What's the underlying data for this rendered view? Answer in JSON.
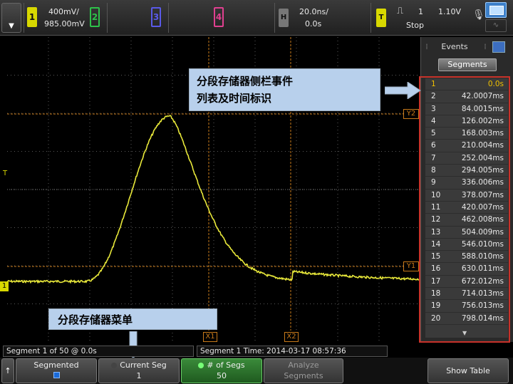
{
  "topbar": {
    "drop_glyph": "▼",
    "ch1": {
      "num": "1",
      "scale": "400mV/",
      "offset": "985.00mV",
      "color": "#d8d800"
    },
    "ch2": {
      "num": "2",
      "color": "#2ec24a"
    },
    "ch3": {
      "num": "3",
      "color": "#5a5ae8"
    },
    "ch4": {
      "num": "4",
      "color": "#e04090"
    },
    "horiz": {
      "label": "H",
      "scale": "20.0ns/",
      "delay": "0.0s"
    },
    "trigger": {
      "label": "T",
      "edge": "⎍",
      "source": "1",
      "level": "1.10V",
      "mode": "Stop",
      "color": "#d8d800"
    },
    "mic_glyph": "🎙",
    "wave_glyph": "∿"
  },
  "markers": {
    "y2": "Y2",
    "y1": "Y1",
    "x1": "X1",
    "x2": "X2",
    "trig": "T",
    "ground": "1"
  },
  "sidebar": {
    "tab_label": "Events",
    "segments_button": "Segments",
    "events": [
      {
        "n": "1",
        "t": "0.0s"
      },
      {
        "n": "2",
        "t": "42.0007ms"
      },
      {
        "n": "3",
        "t": "84.0015ms"
      },
      {
        "n": "4",
        "t": "126.002ms"
      },
      {
        "n": "5",
        "t": "168.003ms"
      },
      {
        "n": "6",
        "t": "210.004ms"
      },
      {
        "n": "7",
        "t": "252.004ms"
      },
      {
        "n": "8",
        "t": "294.005ms"
      },
      {
        "n": "9",
        "t": "336.006ms"
      },
      {
        "n": "10",
        "t": "378.007ms"
      },
      {
        "n": "11",
        "t": "420.007ms"
      },
      {
        "n": "12",
        "t": "462.008ms"
      },
      {
        "n": "13",
        "t": "504.009ms"
      },
      {
        "n": "14",
        "t": "546.010ms"
      },
      {
        "n": "15",
        "t": "588.010ms"
      },
      {
        "n": "16",
        "t": "630.011ms"
      },
      {
        "n": "17",
        "t": "672.012ms"
      },
      {
        "n": "18",
        "t": "714.013ms"
      },
      {
        "n": "19",
        "t": "756.013ms"
      },
      {
        "n": "20",
        "t": "798.014ms"
      }
    ]
  },
  "annotations": {
    "sidebar_line1": "分段存储器侧栏事件",
    "sidebar_line2": "列表及时间标识",
    "menu": "分段存储器菜单"
  },
  "status": {
    "segment_info": "Segment 1 of 50 @ 0.0s",
    "segment_time": "Segment 1 Time: 2014-03-17 08:57:36"
  },
  "softkeys": {
    "back": "↑",
    "segmented": "Segmented",
    "current_seg_label": "Current Seg",
    "current_seg_value": "1",
    "num_segs_label": "# of Segs",
    "num_segs_value": "50",
    "analyze_l1": "Analyze",
    "analyze_l2": "Segments",
    "show_table": "Show Table"
  }
}
